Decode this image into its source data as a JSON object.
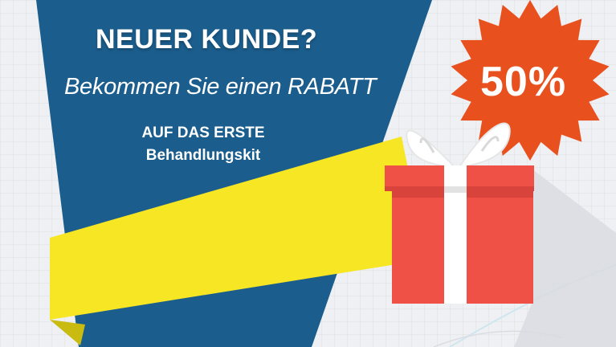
{
  "banner": {
    "headline": "NEUER KUNDE?",
    "subline": "Bekommen Sie einen RABATT",
    "offer_line1": "AUF DAS ERSTE",
    "offer_line2": "Behandlungskit"
  },
  "badge": {
    "discount": "50%"
  },
  "colors": {
    "blue": "#1b5d8c",
    "yellow": "#f6e624",
    "orange": "#e8501e",
    "gift_red": "#ef5147",
    "ribbon_white": "#ffffff",
    "background": "#eef0f3"
  },
  "icons": [
    "gift-box-icon",
    "starburst-badge"
  ]
}
